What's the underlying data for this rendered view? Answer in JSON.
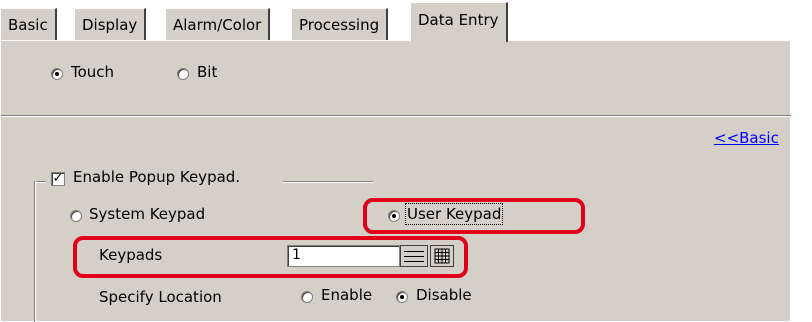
{
  "tabs": [
    {
      "label": "Basic"
    },
    {
      "label": "Display"
    },
    {
      "label": "Alarm/Color"
    },
    {
      "label": "Processing"
    },
    {
      "label": "Data Entry"
    }
  ],
  "mode": {
    "touch_label": "Touch",
    "bit_label": "Bit",
    "selected": "Touch"
  },
  "basic_link": "<<Basic",
  "popup": {
    "enable_label": "Enable Popup Keypad.",
    "enabled": true,
    "system_keypad_label": "System Keypad",
    "user_keypad_label": "User Keypad",
    "selected_keypad": "User Keypad",
    "keypads_label": "Keypads",
    "keypads_value": "1",
    "specify_location_label": "Specify Location",
    "enable_label_loc": "Enable",
    "disable_label_loc": "Disable",
    "selected_location": "Disable"
  },
  "colors": {
    "panel": "#d4d0c8",
    "highlight": "#e0001b",
    "link": "#0000ff"
  }
}
